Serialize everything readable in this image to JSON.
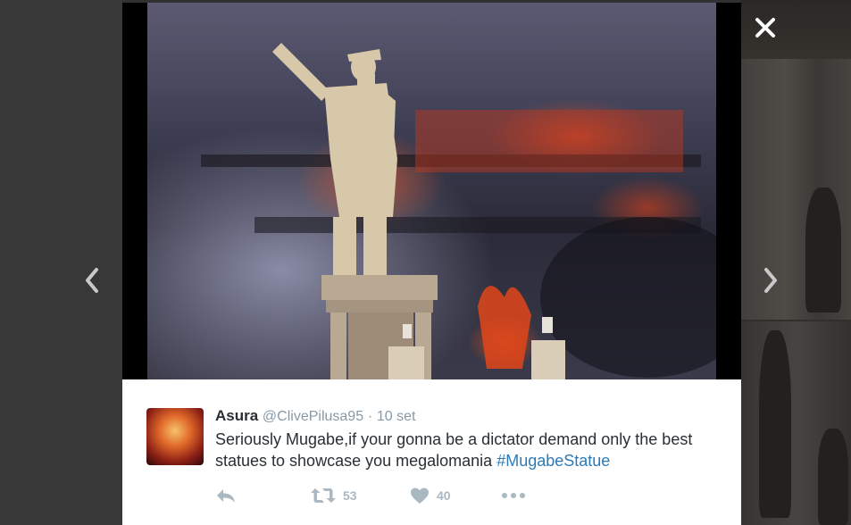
{
  "tweet": {
    "name": "Asura",
    "handle": "@ClivePilusa95",
    "separator": "·",
    "time": "10 set",
    "text": "Seriously Mugabe,if your gonna be a dictator demand only the best statues to showcase you megalomania ",
    "hashtag": "#MugabeStatue",
    "retweets": "53",
    "likes": "40"
  },
  "icons": {
    "close": "close-icon",
    "prev": "chevron-left-icon",
    "next": "chevron-right-icon",
    "reply": "reply-icon",
    "retweet": "retweet-icon",
    "like": "heart-icon",
    "more": "more-icon"
  },
  "colors": {
    "link": "#2b7bb9",
    "muted": "#8899a6",
    "action": "#aab8c2",
    "text": "#292f33"
  }
}
